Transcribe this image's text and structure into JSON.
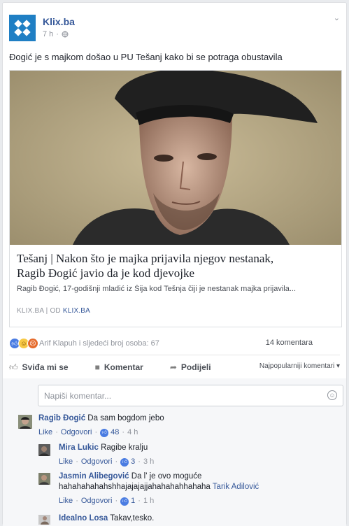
{
  "post": {
    "page_name": "Klix.ba",
    "time": "7 h",
    "privacy_icon": "globe-icon",
    "text": "Đogić je s majkom došao u PU Tešanj kako bi se potraga obustavila"
  },
  "link": {
    "title_line1": "Tešanj | Nakon što je majka prijavila njegov nestanak,",
    "title_line2": "Ragib Đogić javio da je kod djevojke",
    "description": "Ragib Đogić, 17-godišnji mladić iz Šija kod Tešnja čiji je nestanak majka prijavila...",
    "source": "KLIX.BA",
    "separator": "|",
    "by_label": "OD",
    "by_name": "KLIX.BA"
  },
  "reactions": {
    "text": "Arif Klapuh i sljedeći broj osoba: 67",
    "comment_count": "14 komentara"
  },
  "actions": {
    "like": "Sviđa mi se",
    "comment": "Komentar",
    "share": "Podijeli",
    "sort": "Najpopularniji komentari"
  },
  "new_comment": {
    "placeholder": "Napiši komentar..."
  },
  "comments": [
    {
      "name": "Ragib Đogić",
      "text": "Da sam bogdom jebo",
      "like": "Like",
      "reply": "Odgovori",
      "count": "48",
      "time": "4 h"
    },
    {
      "name": "Mira Lukic",
      "text": "Ragibe kralju",
      "like": "Like",
      "reply": "Odgovori",
      "count": "3",
      "time": "3 h"
    },
    {
      "name": "Jasmin Alibegović",
      "text": "Da l' je ovo moguće",
      "text2": "hahahahahahshhajajajajjahahahahhahaha",
      "tag": "Tarik Adilović",
      "like": "Like",
      "reply": "Odgovori",
      "count": "1",
      "time": "1 h"
    },
    {
      "name": "Idealno Losa",
      "text": "Takav,tesko."
    }
  ],
  "colors": {
    "link": "#365899",
    "brand": "#1f7fc4",
    "like_blue": "#4a7ce2"
  }
}
